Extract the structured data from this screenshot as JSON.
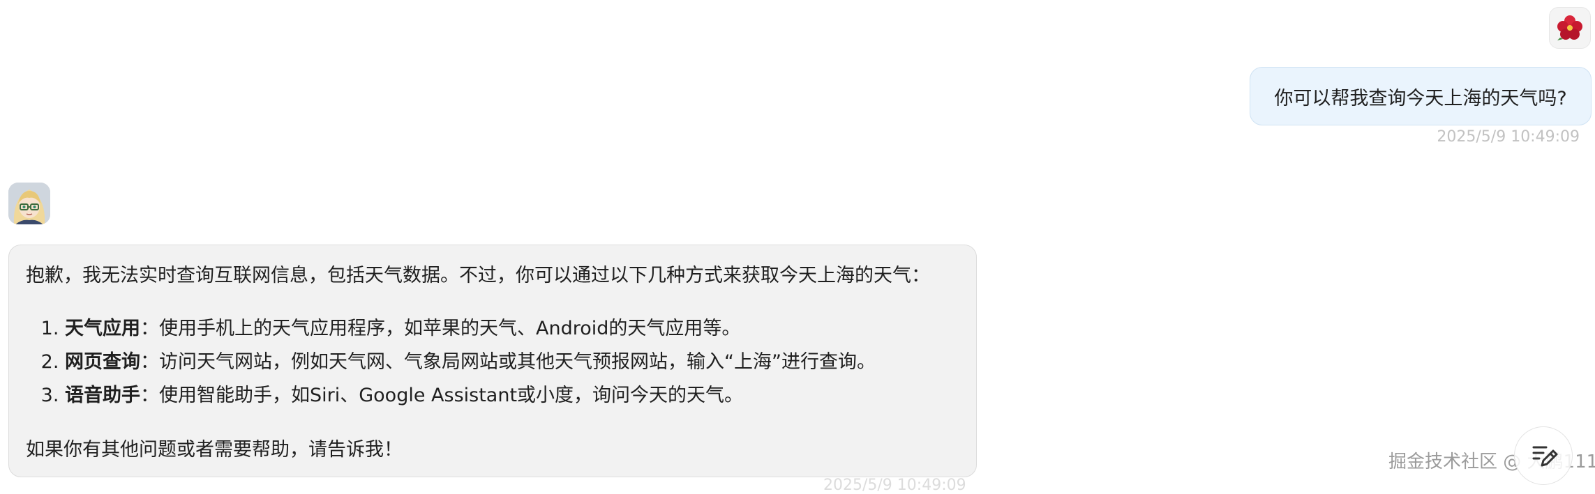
{
  "user_message": {
    "text": "你可以帮我查询今天上海的天气吗?",
    "timestamp": "2025/5/9 10:49:09",
    "avatar_icon": "hibiscus-flower-icon"
  },
  "assistant_message": {
    "avatar_icon": "anime-girl-avatar",
    "intro": "抱歉，我无法实时查询互联网信息，包括天气数据。不过，你可以通过以下几种方式来获取今天上海的天气：",
    "items": [
      {
        "title": "天气应用",
        "text": "：使用手机上的天气应用程序，如苹果的天气、Android的天气应用等。"
      },
      {
        "title": "网页查询",
        "text": "：访问天气网站，例如天气网、气象局网站或其他天气预报网站，输入“上海”进行查询。"
      },
      {
        "title": "语音助手",
        "text": "：使用智能助手，如Siri、Google Assistant或小度，询问今天的天气。"
      }
    ],
    "outro": "如果你有其他问题或者需要帮助，请告诉我！",
    "timestamp": "2025/5/9 10:49:09"
  },
  "watermark": "掘金技术社区 @ 大鹏111",
  "edit_button_icon": "edit-note-icon"
}
